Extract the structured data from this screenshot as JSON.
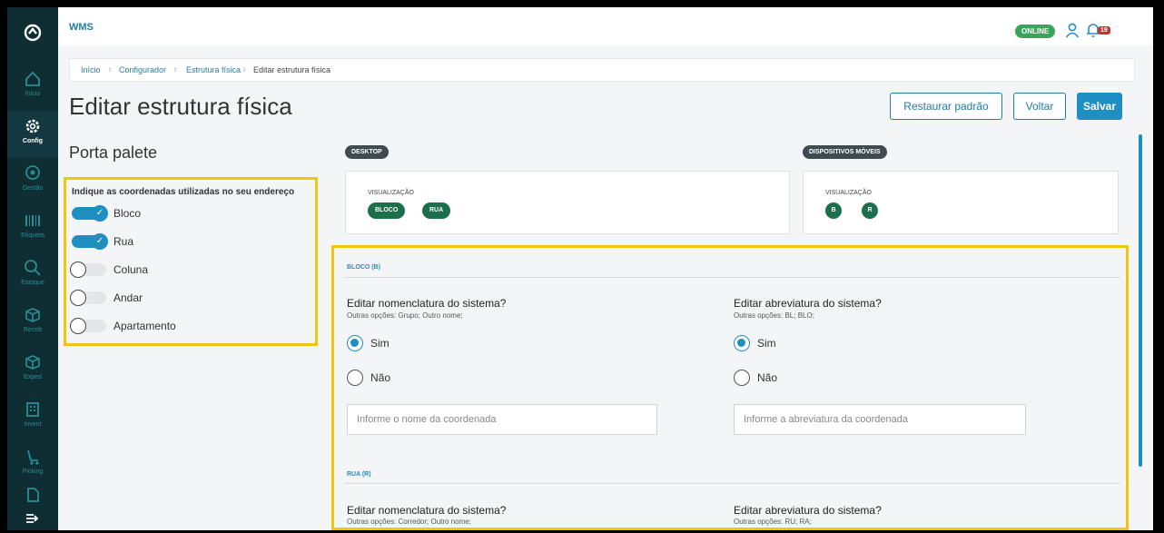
{
  "app": {
    "title": "WMS"
  },
  "header": {
    "status": "ONLINE",
    "notification_count": "19"
  },
  "sidebar": {
    "items": [
      {
        "label": "Início",
        "icon": "home-icon"
      },
      {
        "label": "Config",
        "icon": "gear-icon",
        "active": true
      },
      {
        "label": "Gestão",
        "icon": "location-pin-icon"
      },
      {
        "label": "Etiqueta",
        "icon": "barcode-icon"
      },
      {
        "label": "Estoque",
        "icon": "search-icon"
      },
      {
        "label": "Receb",
        "icon": "box-icon"
      },
      {
        "label": "Exped",
        "icon": "box-icon"
      },
      {
        "label": "Invent",
        "icon": "building-icon"
      },
      {
        "label": "Picking",
        "icon": "hand-cart-icon"
      }
    ]
  },
  "breadcrumb": [
    "Início",
    "Configurador",
    "Estrutura física",
    "Editar estrutura física"
  ],
  "page": {
    "title": "Editar estrutura física"
  },
  "buttons": {
    "restore": "Restaurar padrão",
    "back": "Voltar",
    "save": "Salvar"
  },
  "structure": {
    "name": "Porta palete",
    "coords_heading": "Indique as coordenadas utilizadas no seu endereço",
    "toggles": [
      {
        "label": "Bloco",
        "on": true
      },
      {
        "label": "Rua",
        "on": true
      },
      {
        "label": "Coluna",
        "on": false
      },
      {
        "label": "Andar",
        "on": false
      },
      {
        "label": "Apartamento",
        "on": false
      }
    ]
  },
  "preview": {
    "desktop": {
      "chip": "DESKTOP",
      "label": "VISUALIZAÇÃO",
      "pills": [
        "BLOCO",
        "RUA"
      ]
    },
    "mobile": {
      "chip": "DISPOSITIVOS MÓVEIS",
      "label": "VISUALIZAÇÃO",
      "pills": [
        "B",
        "R"
      ]
    }
  },
  "blocks": [
    {
      "header": "BLOCO (B)",
      "name_q": "Editar nomenclatura do sistema?",
      "name_opts": "Outras opções: Grupo; Outro nome;",
      "abbr_q": "Editar abreviatura do sistema?",
      "abbr_opts": "Outras opções: BL; BLO;",
      "yes": "Sim",
      "no": "Não",
      "name_placeholder": "Informe o nome da coordenada",
      "abbr_placeholder": "Informe a abreviatura da coordenada"
    },
    {
      "header": "RUA (R)",
      "name_q": "Editar nomenclatura do sistema?",
      "name_opts": "Outras opções: Corredor; Outro nome;",
      "abbr_q": "Editar abreviatura do sistema?",
      "abbr_opts": "Outras opções: RU; RA;"
    }
  ],
  "colors": {
    "accent": "#1f8fc2",
    "sidebar": "#0e2e34",
    "highlight": "#f1c40f",
    "online": "#3aa45c",
    "pill": "#1b6f4a"
  }
}
